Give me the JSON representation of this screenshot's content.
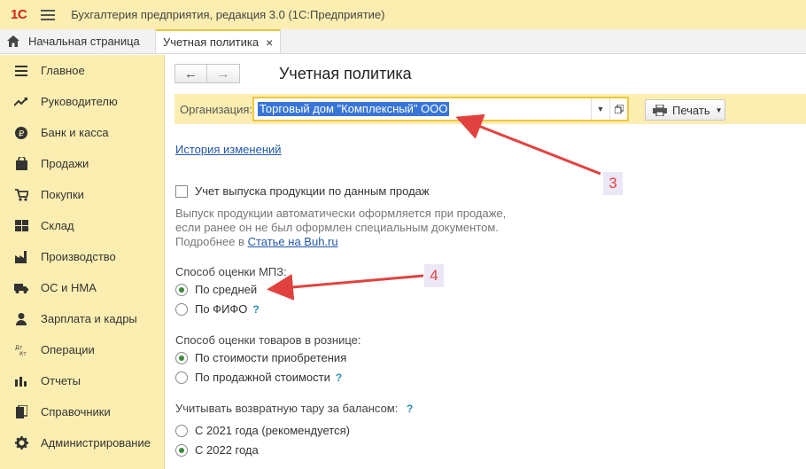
{
  "titlebar": {
    "logo": "1С",
    "title": "Бухгалтерия предприятия, редакция 3.0  (1С:Предприятие)"
  },
  "tabs": [
    {
      "label": "Начальная страница"
    },
    {
      "label": "Учетная политика",
      "close": "×"
    }
  ],
  "sidebar": {
    "items": [
      {
        "label": "Главное",
        "icon": "menu-lines-icon"
      },
      {
        "label": "Руководителю",
        "icon": "trend-icon"
      },
      {
        "label": "Банк и касса",
        "icon": "ruble-coin-icon"
      },
      {
        "label": "Продажи",
        "icon": "shopping-bag-icon"
      },
      {
        "label": "Покупки",
        "icon": "cart-icon"
      },
      {
        "label": "Склад",
        "icon": "warehouse-icon"
      },
      {
        "label": "Производство",
        "icon": "factory-icon"
      },
      {
        "label": "ОС и НМА",
        "icon": "truck-icon"
      },
      {
        "label": "Зарплата и кадры",
        "icon": "person-icon"
      },
      {
        "label": "Операции",
        "icon": "dt-kt-icon"
      },
      {
        "label": "Отчеты",
        "icon": "bar-chart-icon"
      },
      {
        "label": "Справочники",
        "icon": "books-icon"
      },
      {
        "label": "Администрирование",
        "icon": "gear-icon"
      }
    ]
  },
  "main": {
    "nav_back": "←",
    "nav_forward": "→",
    "title": "Учетная политика",
    "org_label": "Организация:",
    "org_value": "Торговый дом \"Комплексный\" ООО",
    "print_label": "Печать",
    "history_link": "История изменений",
    "checkbox_label": "Учет выпуска продукции по данным продаж",
    "hint_line1": "Выпуск продукции автоматически оформляется при продаже,",
    "hint_line2": "если ранее он не был оформлен специальным документом.",
    "hint_line3_prefix": "Подробнее в ",
    "hint_link": "Статье на Buh.ru",
    "mpz_label": "Способ оценки МПЗ:",
    "mpz_options": [
      {
        "label": "По средней",
        "selected": true
      },
      {
        "label": "По ФИФО",
        "selected": false,
        "help": "?"
      }
    ],
    "retail_label": "Способ оценки товаров в рознице:",
    "retail_options": [
      {
        "label": "По стоимости приобретения",
        "selected": true
      },
      {
        "label": "По продажной стоимости",
        "selected": false,
        "help": "?"
      }
    ],
    "tara_label": "Учитывать возвратную тару за балансом:",
    "tara_help": "?",
    "tara_options": [
      {
        "label": "С 2021 года (рекомендуется)",
        "selected": false
      },
      {
        "label": "С 2022 года",
        "selected": true
      }
    ]
  },
  "annotations": [
    {
      "number": "3"
    },
    {
      "number": "4"
    }
  ],
  "colors": {
    "accent": "#fbeeb0",
    "field_border": "#f0c63c",
    "selection": "#3875d7",
    "annotation_arrow": "#e2423f",
    "link": "#2257a8"
  }
}
